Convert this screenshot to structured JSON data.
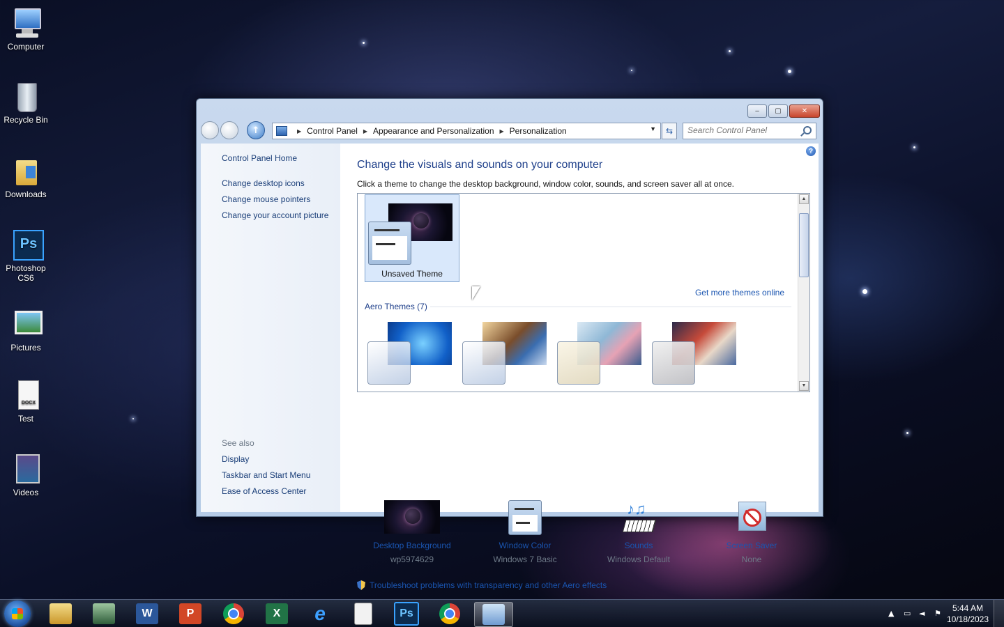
{
  "desktop": {
    "icons": [
      {
        "label": "Computer",
        "icon": "computer-icon"
      },
      {
        "label": "Recycle Bin",
        "icon": "recycle-bin-icon"
      },
      {
        "label": "Downloads",
        "icon": "folder-shortcut-icon"
      },
      {
        "label": "Photoshop CS6",
        "icon": "photoshop-icon"
      },
      {
        "label": "Pictures",
        "icon": "pictures-icon"
      },
      {
        "label": "Test",
        "icon": "docx-file-icon"
      },
      {
        "label": "Videos",
        "icon": "videos-icon"
      }
    ]
  },
  "window": {
    "breadcrumb": [
      "Control Panel",
      "Appearance and Personalization",
      "Personalization"
    ],
    "search_placeholder": "Search Control Panel",
    "sidebar": {
      "home": "Control Panel Home",
      "links": [
        "Change desktop icons",
        "Change mouse pointers",
        "Change your account picture"
      ],
      "see_also_title": "See also",
      "see_also": [
        "Display",
        "Taskbar and Start Menu",
        "Ease of Access Center"
      ]
    },
    "main": {
      "heading": "Change the visuals and sounds on your computer",
      "subtext": "Click a theme to change the desktop background, window color, sounds, and screen saver all at once.",
      "selected_theme": "Unsaved Theme",
      "more_themes_link": "Get more themes online",
      "aero_section": "Aero Themes (7)",
      "bottom": [
        {
          "label": "Desktop Background",
          "value": "wp5974629",
          "icon": "desktop-background-icon"
        },
        {
          "label": "Window Color",
          "value": "Windows 7 Basic",
          "icon": "window-color-icon"
        },
        {
          "label": "Sounds",
          "value": "Windows Default",
          "icon": "sounds-icon"
        },
        {
          "label": "Screen Saver",
          "value": "None",
          "icon": "screen-saver-icon"
        }
      ],
      "troubleshoot": "Troubleshoot problems with transparency and other Aero effects"
    }
  },
  "taskbar": {
    "apps": [
      "file-explorer-icon",
      "task-manager-icon",
      "word-icon",
      "powerpoint-icon",
      "chrome-icon",
      "excel-icon",
      "internet-explorer-icon",
      "calculator-icon",
      "photoshop-icon",
      "chrome-icon",
      "control-panel-icon"
    ],
    "time": "5:44 AM",
    "date": "10/18/2023"
  }
}
